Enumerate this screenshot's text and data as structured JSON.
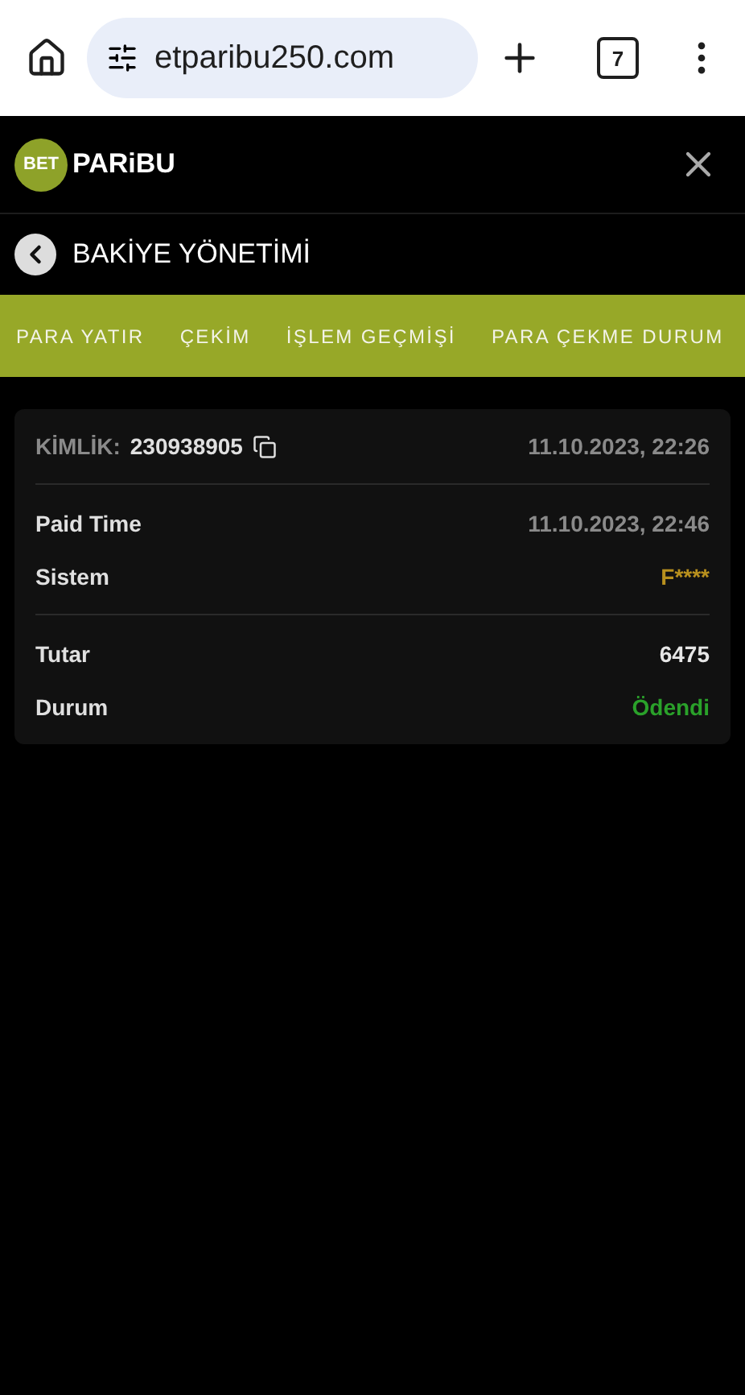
{
  "browser": {
    "url": "etparibu250.com",
    "tab_count": "7"
  },
  "header": {
    "logo_badge": "BET",
    "logo_text": "PARiBU"
  },
  "page_title": "BAKİYE YÖNETİMİ",
  "tabs": [
    "PARA YATIR",
    "ÇEKİM",
    "İŞLEM GEÇMİŞİ",
    "PARA ÇEKME DURUM"
  ],
  "card": {
    "id_label": "KİMLİK:",
    "id_value": "230938905",
    "created": "11.10.2023, 22:26",
    "groups": [
      [
        {
          "label": "Paid Time",
          "value": "11.10.2023, 22:46",
          "color": "#8a8a8a"
        },
        {
          "label": "Sistem",
          "value": "F****",
          "color": "#b8901e"
        }
      ],
      [
        {
          "label": "Tutar",
          "value": "6475",
          "color": "#e6e6e6"
        },
        {
          "label": "Durum",
          "value": "Ödendi",
          "color": "#2aa12a"
        }
      ]
    ]
  }
}
